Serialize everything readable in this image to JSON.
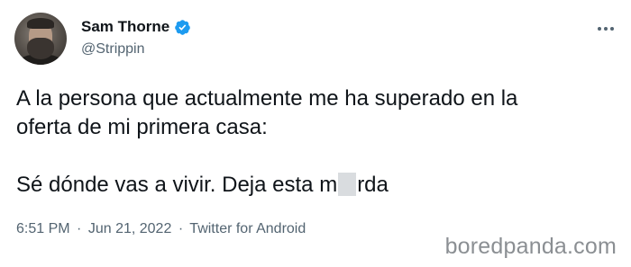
{
  "author": {
    "name": "Sam Thorne",
    "handle": "@Strippin",
    "verified": true,
    "avatar": "avatar-photo"
  },
  "tweet": {
    "line1": "A la persona que actualmente me ha superado en la",
    "line2": "oferta de mi primera casa:",
    "line3_before": "Sé dónde vas a vivir. Deja esta m",
    "line3_after": "rda"
  },
  "meta": {
    "time": "6:51 PM",
    "date": "Jun 21, 2022",
    "source": "Twitter for Android",
    "separator": "·"
  },
  "watermark": "boredpanda.com",
  "icons": {
    "verified": "verified-badge-icon",
    "more": "more-options-icon"
  },
  "colors": {
    "text": "#0f1419",
    "secondary": "#536471",
    "verified": "#1d9bf0",
    "censor": "#d9dcdf"
  }
}
